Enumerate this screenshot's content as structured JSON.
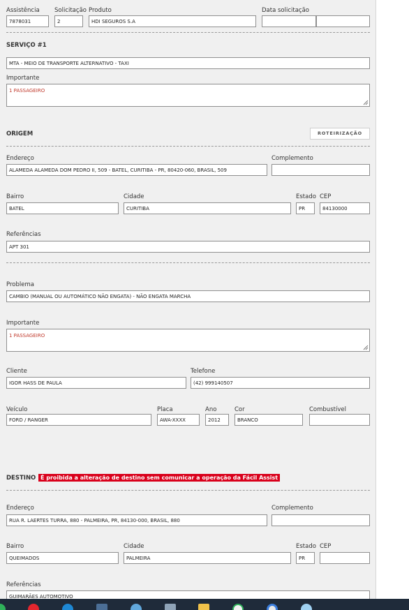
{
  "header": {
    "assistencia_label": "Assistência",
    "assistencia_value": "7878031",
    "solicitacao_label": "Solicitação",
    "solicitacao_value": "2",
    "produto_label": "Produto",
    "produto_value": "HDI SEGUROS S.A",
    "data_solicitacao_label": "Data solicitação",
    "data_value": "",
    "hora_value": ""
  },
  "servico": {
    "title": "SERVIÇO #1",
    "service_value": "MTA - MEIO DE TRANSPORTE ALTERNATIVO - TAXI",
    "importante_label": "Importante",
    "importante_value": "1 PASSAGEIRO"
  },
  "origem": {
    "title": "ORIGEM",
    "routing_button": "ROTEIRIZAÇÃO",
    "endereco_label": "Endereço",
    "endereco_value": "ALAMEDA  ALAMEDA DOM PEDRO II, 509 - BATEL, CURITIBA - PR, 80420-060, BRASIL, 509",
    "complemento_label": "Complemento",
    "complemento_value": "",
    "bairro_label": "Bairro",
    "bairro_value": "BATEL",
    "cidade_label": "Cidade",
    "cidade_value": "CURITIBA",
    "estado_label": "Estado",
    "estado_value": "PR",
    "cep_label": "CEP",
    "cep_value": "84130000",
    "referencias_label": "Referências",
    "referencias_value": "APT 301"
  },
  "problema": {
    "problema_label": "Problema",
    "problema_value": "CAMBIO (MANUAL OU AUTOMÁTICO NÃO ENGATA) - NÃO ENGATA MARCHA",
    "importante_label": "Importante",
    "importante_value": "1 PASSAGEIRO",
    "cliente_label": "Cliente",
    "cliente_value": "IGOR HASS DE PAULA",
    "telefone_label": "Telefone",
    "telefone_value": "(42) 999140507",
    "veiculo_label": "Veículo",
    "veiculo_value": "FORD / RANGER",
    "placa_label": "Placa",
    "placa_value": "AWA-XXXX",
    "ano_label": "Ano",
    "ano_value": "2012",
    "cor_label": "Cor",
    "cor_value": "BRANCO",
    "combustivel_label": "Combustível",
    "combustivel_value": ""
  },
  "destino": {
    "title": "DESTINO",
    "warning": "É proibida a alteração de destino sem comunicar a operação da Fácil Assist",
    "endereco_label": "Endereço",
    "endereco_value": "RUA R. LAERTES TURRA, 880 - PALMEIRA, PR, 84130-000, BRASIL, 880",
    "complemento_label": "Complemento",
    "complemento_value": "",
    "bairro_label": "Bairro",
    "bairro_value": "QUEIMADOS",
    "cidade_label": "Cidade",
    "cidade_value": "PALMEIRA",
    "estado_label": "Estado",
    "estado_value": "PR",
    "cep_label": "CEP",
    "cep_value": "",
    "referencias_label": "Referências",
    "referencias_value": "GUIMARÃES AUTOMOTIVO"
  },
  "colors": {
    "panel": "#f0f0f0",
    "important_text": "#c0392b",
    "warning_bg": "#d9001b",
    "taskbar": "#1f2b3a"
  },
  "taskbar": {
    "icons": [
      "chrome-icon",
      "opera-icon",
      "edge-icon",
      "calculator-icon",
      "browser-icon",
      "notes-icon",
      "folder-icon",
      "whatsapp-icon",
      "chrome-alt-icon",
      "globe-icon"
    ]
  }
}
